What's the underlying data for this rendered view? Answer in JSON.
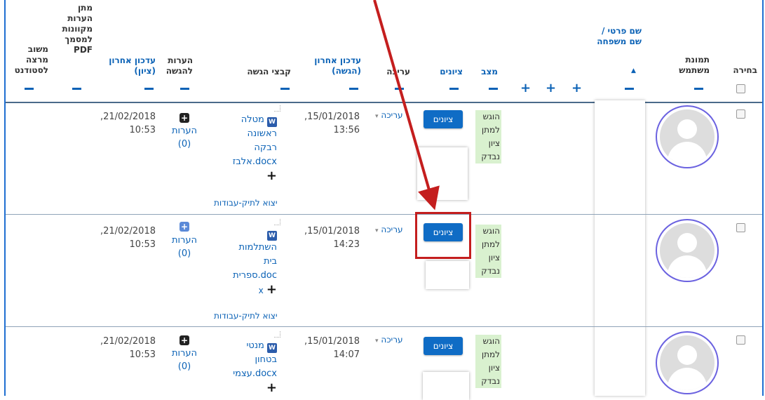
{
  "columns": {
    "select": "בחירה",
    "user_picture": "תמונת משתמש",
    "name": "שם פרטי / שם משפחה",
    "sort_indicator": "▲",
    "status": "מצב",
    "grades": "ציונים",
    "edit": "עריכה",
    "last_modified_submission": "עדכון אחרון (הגשה)",
    "submission_files": "קבצי הגשה",
    "submission_comments": "הערות להגשה",
    "last_modified_grade": "עדכון אחרון (ציון)",
    "annotate_pdf": "מתן הערות מקוונות למסמך PDF",
    "feedback_to_student": "משוב מרצה לסטודנט",
    "collapse_symbol": "−",
    "expand_symbol": "+"
  },
  "rows": [
    {
      "status": "הוגש למתן ציון נבדק",
      "grade_button": "ציונים",
      "edit_label": "עריכה",
      "edit_caret": "▾",
      "submission_date": ",15/01/2018",
      "submission_time": "13:56",
      "file_icon": "W",
      "file_name_lines": [
        "מטלה",
        "ראשונה",
        "רבקה",
        "אלבז.docx"
      ],
      "file_add": "+",
      "file_extra": "",
      "portfolio_link": "יצוא לתיק-עבודות",
      "comments_label": "הערות",
      "comments_count": "(0)",
      "comments_icon": "+",
      "grade_date": ",21/02/2018",
      "grade_time": "10:53"
    },
    {
      "status": "הוגש למתן ציון נבדק",
      "grade_button": "ציונים",
      "edit_label": "עריכה",
      "edit_caret": "▾",
      "submission_date": ",15/01/2018",
      "submission_time": "14:23",
      "file_icon": "W",
      "file_name_lines": [
        "",
        "השתלמות",
        "בית",
        "ספרית.doc"
      ],
      "file_add": "+",
      "file_extra": "x",
      "portfolio_link": "יצוא לתיק-עבודות",
      "comments_label": "הערות",
      "comments_count": "(0)",
      "comments_icon": "+",
      "grade_date": ",21/02/2018",
      "grade_time": "10:53"
    },
    {
      "status": "הוגש למתן ציון נבדק",
      "grade_button": "ציונים",
      "edit_label": "עריכה",
      "edit_caret": "▾",
      "submission_date": ",15/01/2018",
      "submission_time": "14:07",
      "file_icon": "W",
      "file_name_lines": [
        "מנטי",
        "בטחון",
        "עצמי.docx"
      ],
      "file_add": "+",
      "file_extra": "",
      "portfolio_link": "",
      "comments_label": "הערות",
      "comments_count": "(0)",
      "comments_icon": "+",
      "grade_date": ",21/02/2018",
      "grade_time": "10:53"
    }
  ],
  "colors": {
    "link": "#0b62b6",
    "button": "#0f6cc5",
    "status_bg": "#d9f1cf",
    "annotation": "#c41e1e"
  }
}
